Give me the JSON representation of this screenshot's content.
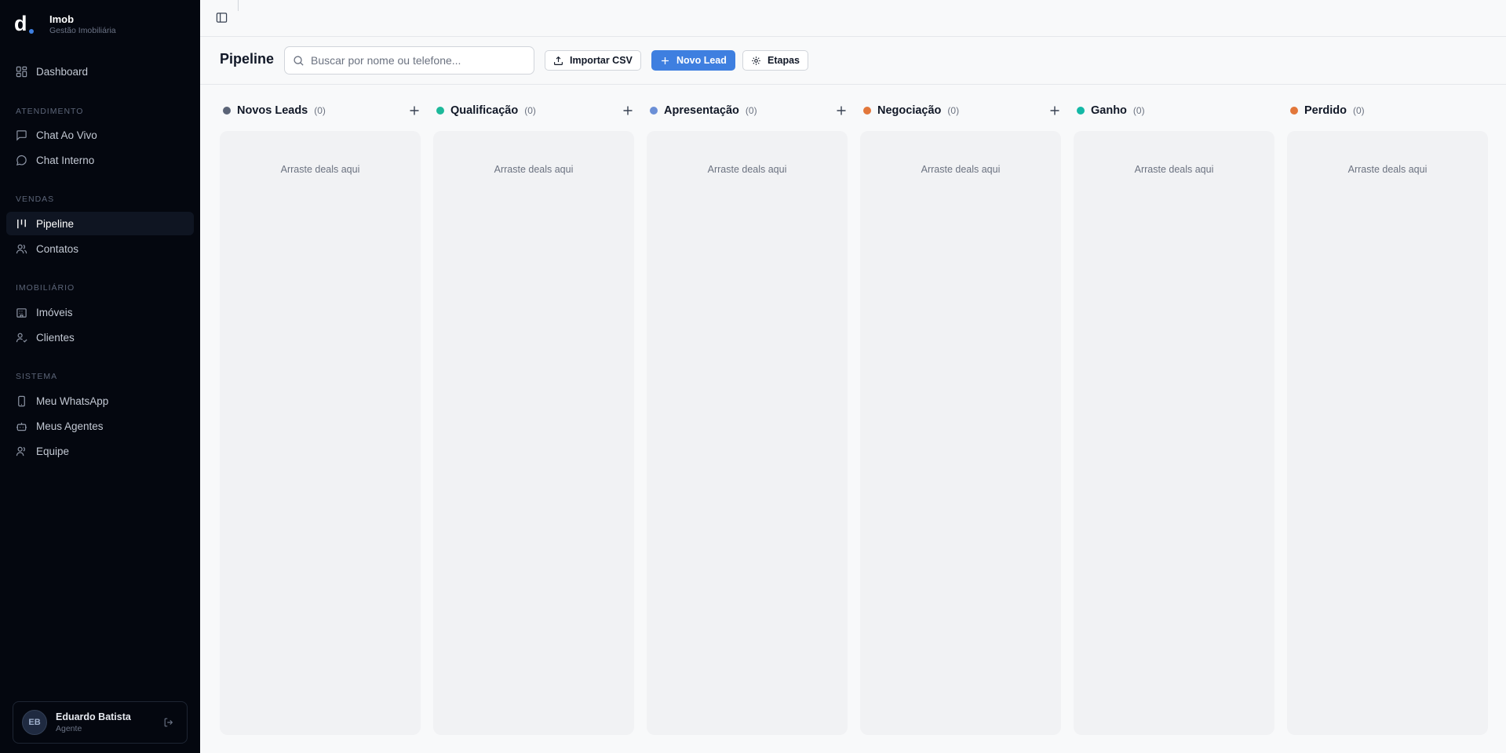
{
  "brand": {
    "name": "Imob",
    "subtitle": "Gestão Imobiliária",
    "logo_letter": "d"
  },
  "sidebar": {
    "items": [
      {
        "label": "Dashboard",
        "icon": "dashboard-icon"
      }
    ],
    "sections": [
      {
        "title": "ATENDIMENTO",
        "items": [
          {
            "label": "Chat Ao Vivo",
            "icon": "message-square-icon"
          },
          {
            "label": "Chat Interno",
            "icon": "message-circle-icon"
          }
        ]
      },
      {
        "title": "VENDAS",
        "items": [
          {
            "label": "Pipeline",
            "icon": "pipeline-icon",
            "active": true
          },
          {
            "label": "Contatos",
            "icon": "users-icon"
          }
        ]
      },
      {
        "title": "IMOBILIÁRIO",
        "items": [
          {
            "label": "Imóveis",
            "icon": "building-icon"
          },
          {
            "label": "Clientes",
            "icon": "user-check-icon"
          }
        ]
      },
      {
        "title": "SISTEMA",
        "items": [
          {
            "label": "Meu WhatsApp",
            "icon": "smartphone-icon"
          },
          {
            "label": "Meus Agentes",
            "icon": "bot-icon"
          },
          {
            "label": "Equipe",
            "icon": "team-icon"
          }
        ]
      }
    ]
  },
  "user": {
    "initials": "EB",
    "name": "Eduardo Batista",
    "role": "Agente"
  },
  "toolbar": {
    "title": "Pipeline",
    "search_placeholder": "Buscar por nome ou telefone...",
    "import_label": "Importar CSV",
    "new_lead_label": "Novo Lead",
    "stages_label": "Etapas"
  },
  "columns": [
    {
      "title": "Novos Leads",
      "count": "(0)",
      "color": "#5b6477",
      "empty": "Arraste deals aqui",
      "addable": true
    },
    {
      "title": "Qualificação",
      "count": "(0)",
      "color": "#1db99a",
      "empty": "Arraste deals aqui",
      "addable": true
    },
    {
      "title": "Apresentação",
      "count": "(0)",
      "color": "#6b8fd6",
      "empty": "Arraste deals aqui",
      "addable": true
    },
    {
      "title": "Negociação",
      "count": "(0)",
      "color": "#e2773a",
      "empty": "Arraste deals aqui",
      "addable": true
    },
    {
      "title": "Ganho",
      "count": "(0)",
      "color": "#14b8a6",
      "empty": "Arraste deals aqui",
      "addable": false
    },
    {
      "title": "Perdido",
      "count": "(0)",
      "color": "#e2773a",
      "empty": "Arraste deals aqui",
      "addable": false
    }
  ],
  "colors": {
    "sidebar_bg": "#04070f",
    "primary": "#3e7fe0",
    "page_bg": "#f8f9fa"
  }
}
